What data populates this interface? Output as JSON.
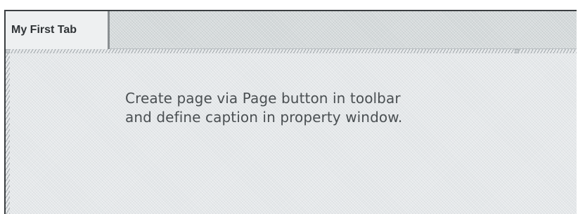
{
  "tabs": [
    {
      "label": "My First Tab",
      "selected": true
    }
  ],
  "placeholder": {
    "line1": "Create page via Page button in toolbar",
    "line2": "and define caption in property window."
  },
  "colors": {
    "tab_strip": "#d4d9da",
    "tab_selected": "#eef0f1",
    "content_background": "#e4e7e9",
    "text": "#4a4f52"
  }
}
